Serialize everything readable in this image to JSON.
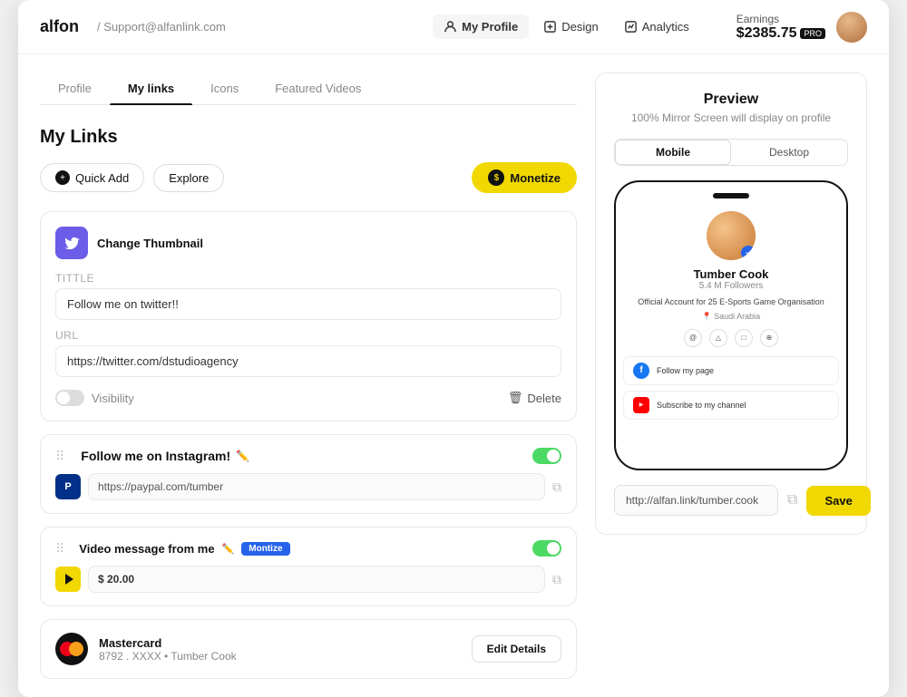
{
  "header": {
    "logo": "alfon",
    "separator": "/",
    "support_email": "Support@alfanlink.com",
    "nav": [
      {
        "id": "my-profile",
        "label": "My Profile",
        "active": true
      },
      {
        "id": "design",
        "label": "Design",
        "active": false
      },
      {
        "id": "analytics",
        "label": "Analytics",
        "active": false
      }
    ],
    "earnings_label": "Earnings",
    "earnings_amount": "$2385.75",
    "earnings_badge": "PRO"
  },
  "tabs": [
    {
      "id": "profile",
      "label": "Profile",
      "active": false
    },
    {
      "id": "my-links",
      "label": "My links",
      "active": true
    },
    {
      "id": "icons",
      "label": "Icons",
      "active": false
    },
    {
      "id": "featured-videos",
      "label": "Featured Videos",
      "active": false
    }
  ],
  "main": {
    "section_title": "My Links",
    "btn_quick_add": "Quick Add",
    "btn_explore": "Explore",
    "btn_monetize": "Monetize",
    "twitter_card": {
      "thumbnail_label": "Change Thumbnail",
      "title_label": "TITTLE",
      "title_value": "Follow me on twitter!!",
      "url_label": "URL",
      "url_value": "https://twitter.com/dstudioagency",
      "visibility_label": "Visibility",
      "delete_label": "Delete"
    },
    "instagram_card": {
      "title": "Follow me on Instagram!",
      "url": "https://paypal.com/tumber",
      "toggle": true
    },
    "video_card": {
      "title": "Video message from me",
      "badge": "Montize",
      "price": "$ 20.00",
      "toggle": true
    },
    "mastercard": {
      "name": "Mastercard",
      "details": "8792 . XXXX  •  Tumber Cook",
      "edit_label": "Edit  Details"
    }
  },
  "preview": {
    "title": "Preview",
    "subtitle": "100% Mirror Screen will display on profile",
    "tabs": [
      {
        "label": "Mobile",
        "active": true
      },
      {
        "label": "Desktop",
        "active": false
      }
    ],
    "profile": {
      "name": "Tumber Cook",
      "followers": "5.4 M Followers",
      "bio": "Official Account for 25 E-Sports Game Organisation",
      "location": "Saudi Arabia",
      "links": [
        {
          "icon": "facebook",
          "text": "Follow my page"
        },
        {
          "icon": "youtube",
          "text": "Subscribe to my channel"
        }
      ]
    },
    "url_bar": {
      "value": "http://alfan.link/tumber.cook",
      "save_label": "Save"
    }
  }
}
